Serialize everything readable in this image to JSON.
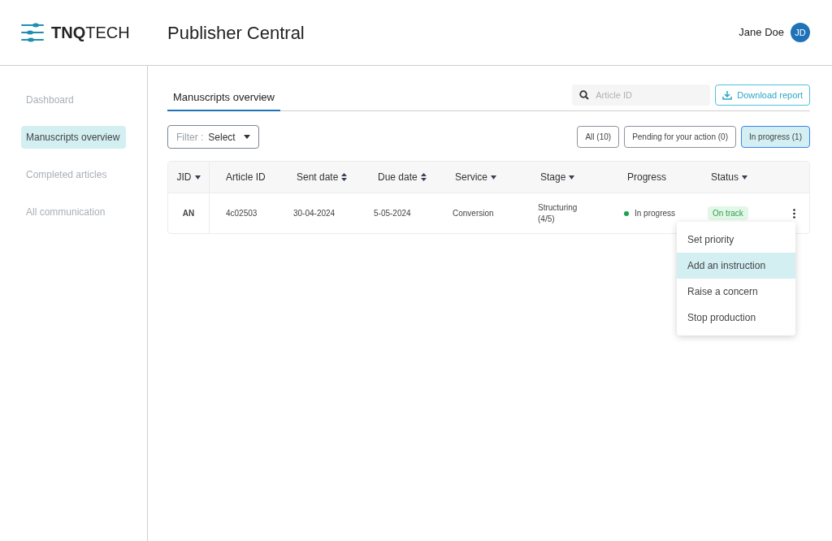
{
  "header": {
    "logo": "**TNQ**TECH",
    "title": "Publisher Central",
    "user": {
      "name": "Jane Doe",
      "initials": "JD"
    }
  },
  "sidebar": {
    "items": [
      {
        "label": "Dashboard",
        "selected": false
      },
      {
        "label": "Manuscripts overview",
        "selected": true
      },
      {
        "label": "Completed articles",
        "selected": false
      },
      {
        "label": "All communication",
        "selected": false
      }
    ]
  },
  "tabs": [
    {
      "label": "Manuscripts overview",
      "selected": true
    }
  ],
  "search": {
    "placeholder": "Article ID"
  },
  "download_button": "Download report",
  "filter": {
    "label": "Filter :",
    "value": "Select"
  },
  "segments": [
    {
      "label": "All (10)",
      "selected": false
    },
    {
      "label": "Pending for your action (0)",
      "selected": false
    },
    {
      "label": "In progress (1)",
      "selected": true
    }
  ],
  "table": {
    "columns": [
      {
        "label": "JID",
        "kind": "dropdown"
      },
      {
        "label": "Article ID",
        "kind": "plain"
      },
      {
        "label": "Sent date",
        "kind": "sort"
      },
      {
        "label": "Due date",
        "kind": "sort"
      },
      {
        "label": "Service",
        "kind": "dropdown"
      },
      {
        "label": "Stage",
        "kind": "dropdown"
      },
      {
        "label": "Progress",
        "kind": "plain"
      },
      {
        "label": "Status",
        "kind": "dropdown"
      }
    ],
    "rows": [
      {
        "jid": "AN",
        "article_id": "4c02503",
        "sent_date": "30-04-2024",
        "due_date": "5-05-2024",
        "service": "Conversion",
        "stage": "Structuring",
        "stage_step": "(4/5)",
        "progress": {
          "label": "In progress",
          "color": "#16a34a"
        },
        "status": "On track"
      }
    ]
  },
  "row_menu": {
    "items": [
      {
        "label": "Set priority",
        "selected": false
      },
      {
        "label": "Add an instruction",
        "selected": true
      },
      {
        "label": "Raise a concern",
        "selected": false
      },
      {
        "label": "Stop production",
        "selected": false
      }
    ]
  }
}
